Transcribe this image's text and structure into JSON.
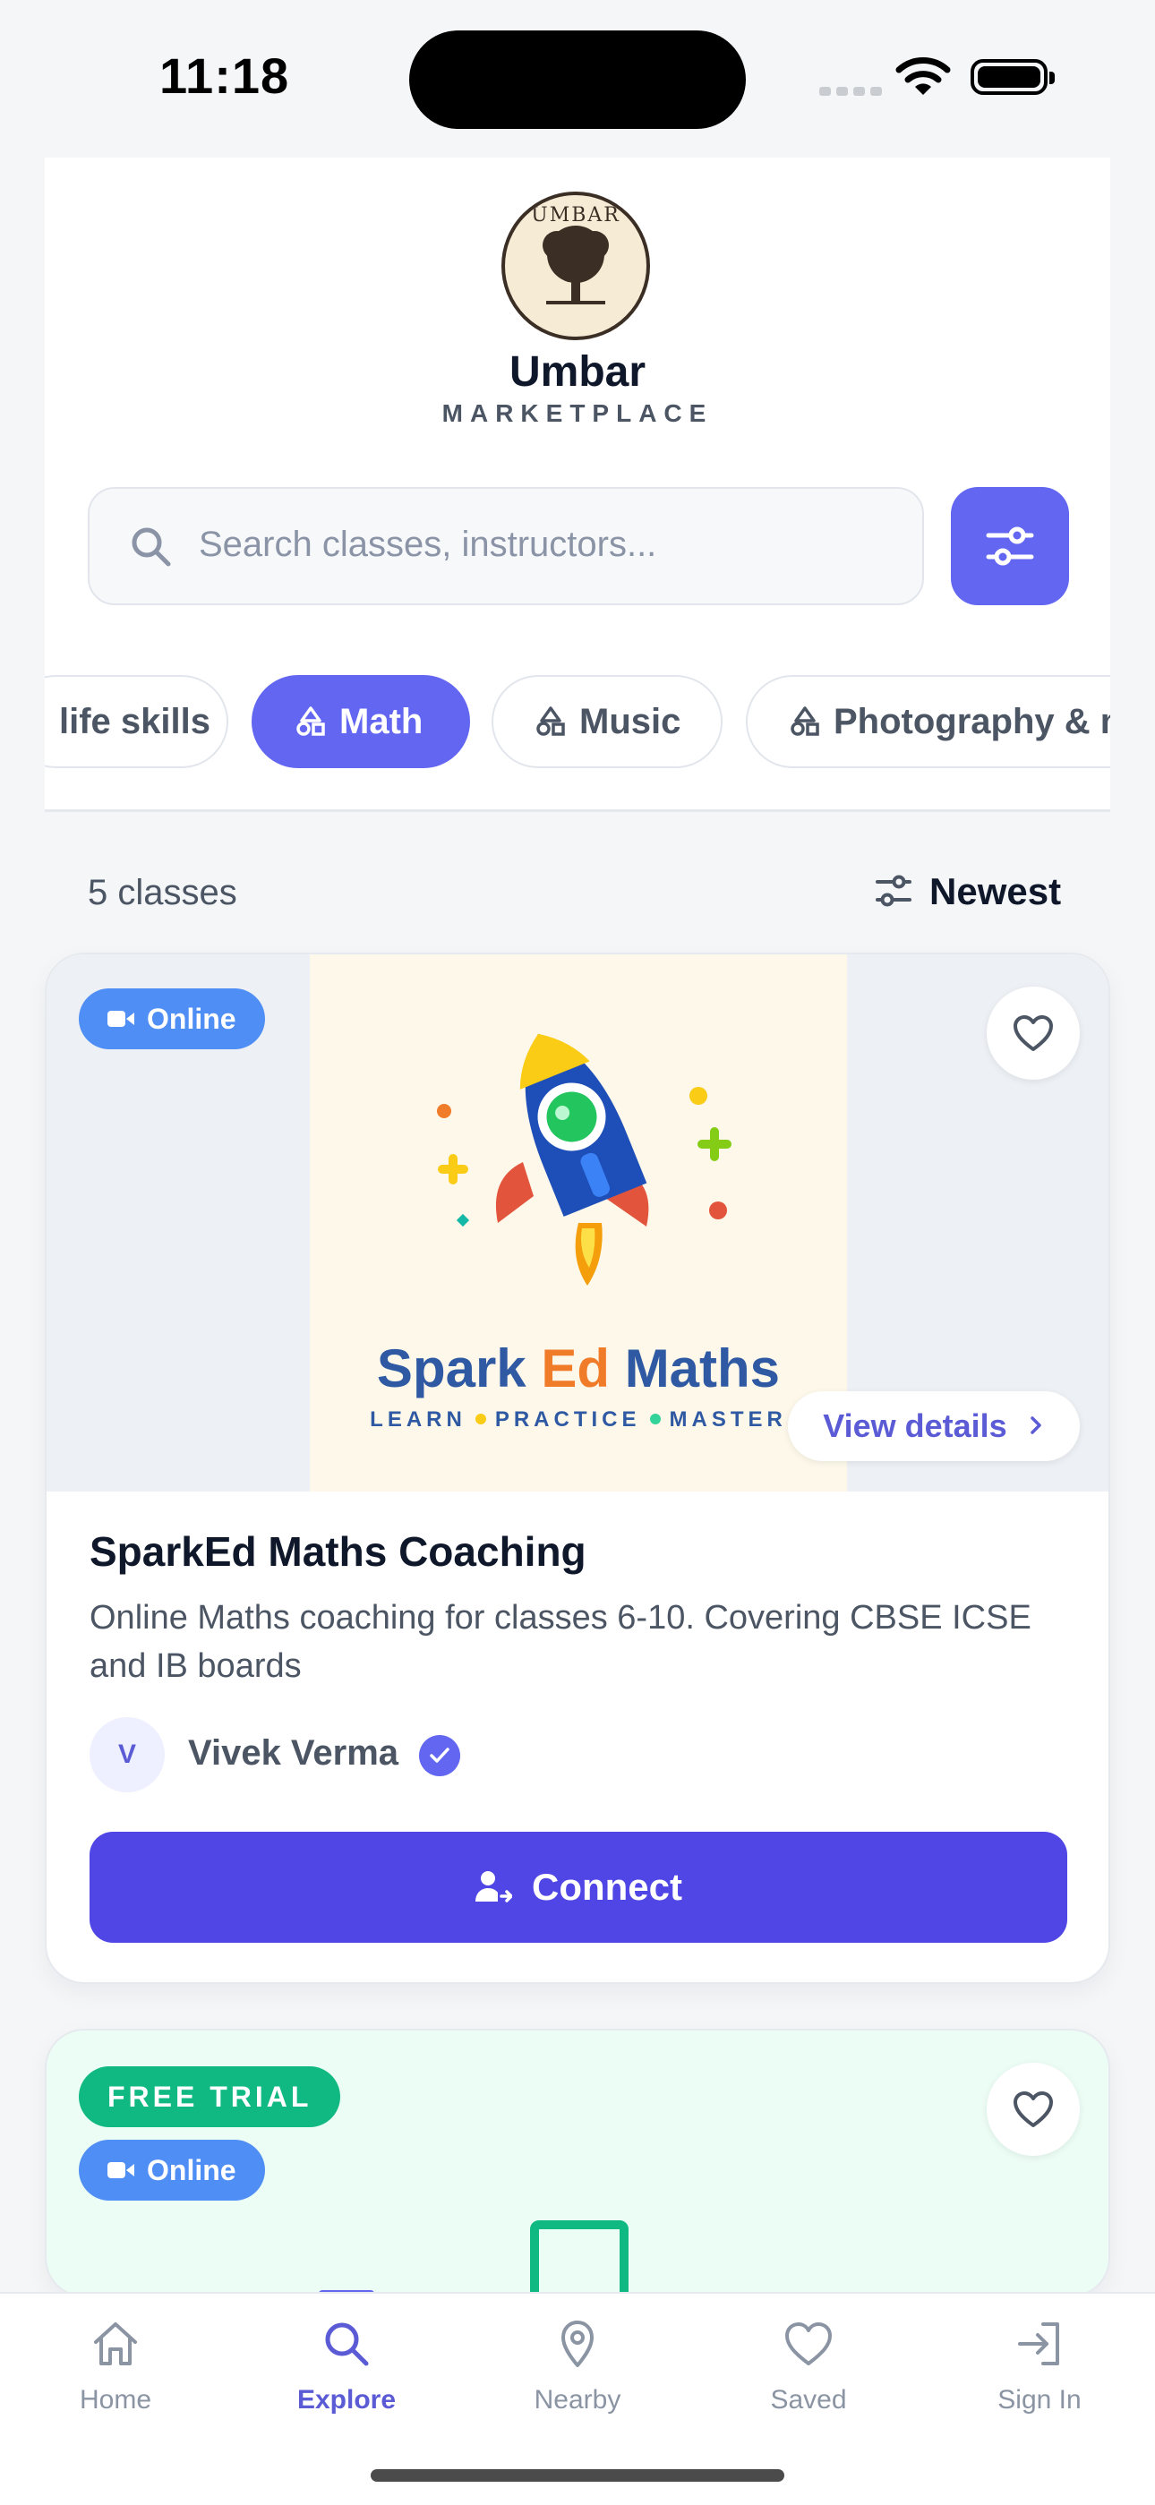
{
  "status_bar": {
    "time": "11:18"
  },
  "header": {
    "logo_text": "UMBAR",
    "brand": "Umbar",
    "subtitle": "MARKETPLACE"
  },
  "search": {
    "placeholder": "Search classes, instructors..."
  },
  "categories": [
    {
      "label": "life skills",
      "active": false
    },
    {
      "label": "Math",
      "active": true
    },
    {
      "label": "Music",
      "active": false
    },
    {
      "label": "Photography & m",
      "active": false
    }
  ],
  "results": {
    "count_label": "5 classes",
    "sort_label": "Newest"
  },
  "cards": [
    {
      "badges": [
        "Online"
      ],
      "poster_title_a": "Spark ",
      "poster_title_b": "Ed",
      "poster_title_c": " Maths",
      "poster_words": [
        "LEARN",
        "PRACTICE",
        "MASTER"
      ],
      "view_details": "View details",
      "title": "SparkEd Maths Coaching",
      "description": "Online Maths coaching for classes 6-10. Covering CBSE ICSE and IB boards",
      "instructor_initial": "V",
      "instructor": "Vivek Verma",
      "cta": "Connect"
    },
    {
      "badges": [
        "FREE TRIAL",
        "Online"
      ]
    }
  ],
  "tabs": [
    {
      "label": "Home",
      "icon": "home-icon",
      "active": false
    },
    {
      "label": "Explore",
      "icon": "search-icon",
      "active": true
    },
    {
      "label": "Nearby",
      "icon": "map-pin-icon",
      "active": false
    },
    {
      "label": "Saved",
      "icon": "heart-icon",
      "active": false
    },
    {
      "label": "Sign In",
      "icon": "sign-in-icon",
      "active": false
    }
  ],
  "colors": {
    "accent": "#6366f1",
    "primary_button": "#4f46e5",
    "online_badge": "#4f8ef5",
    "trial_badge": "#10b981"
  }
}
